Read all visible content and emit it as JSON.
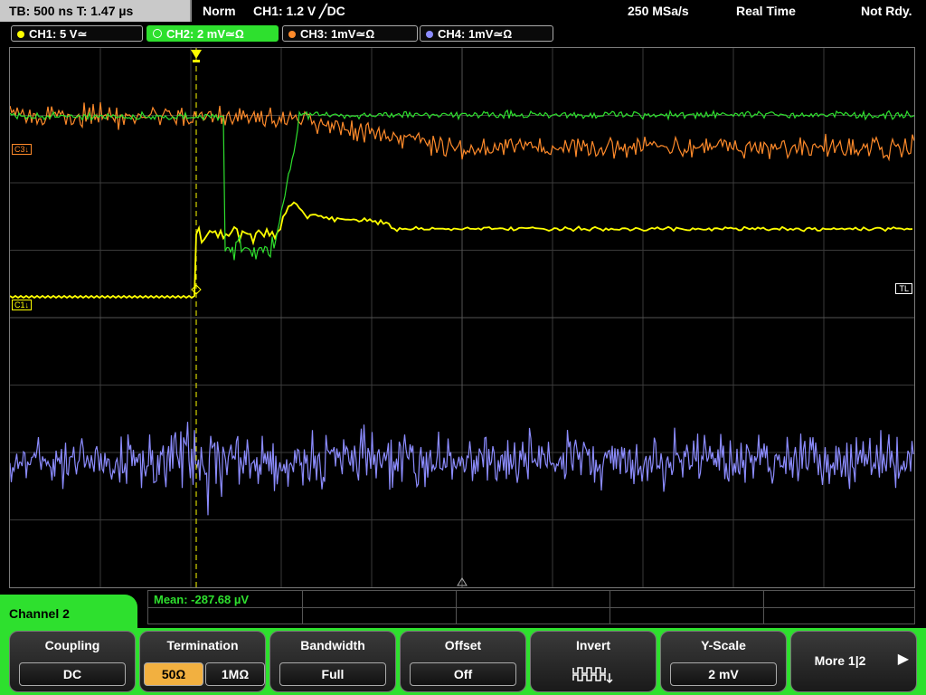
{
  "topbar": {
    "timebase": "TB: 500 ns   T: 1.47 µs",
    "mode": "Norm",
    "trigger": "CH1: 1.2 V ╱DC",
    "sample_rate": "250 MSa/s",
    "acq_mode": "Real Time",
    "status": "Not Rdy."
  },
  "channels": [
    {
      "label": "CH1: 5 V≃",
      "color": "#ffff00"
    },
    {
      "label": "CH2: 2 mV≃Ω",
      "color": "#2ee02e"
    },
    {
      "label": "CH3: 1mV≃Ω",
      "color": "#ff8a2a"
    },
    {
      "label": "CH4: 1mV≃Ω",
      "color": "#8c8cff"
    }
  ],
  "markers": {
    "c3": "C3↓",
    "c1": "C1↓",
    "tl": "TL"
  },
  "measurement": {
    "text": "Mean: -287.68 µV"
  },
  "menu": {
    "title": "Channel 2",
    "coupling": {
      "label": "Coupling",
      "value": "DC"
    },
    "termination": {
      "label": "Termination",
      "opt1": "50Ω",
      "opt2": "1MΩ"
    },
    "bandwidth": {
      "label": "Bandwidth",
      "value": "Full"
    },
    "offset": {
      "label": "Offset",
      "value": "Off"
    },
    "invert": {
      "label": "Invert",
      "icon": "invert-waveform-icon"
    },
    "yscale": {
      "label": "Y-Scale",
      "value": "2 mV"
    },
    "more": {
      "label": "More 1|2"
    }
  },
  "colors": {
    "ch1": "#ffff00",
    "ch2": "#2ee02e",
    "ch3": "#ff8a2a",
    "ch4": "#8c8cff",
    "menu_accent": "#2ee02e",
    "selected": "#f2b040"
  }
}
